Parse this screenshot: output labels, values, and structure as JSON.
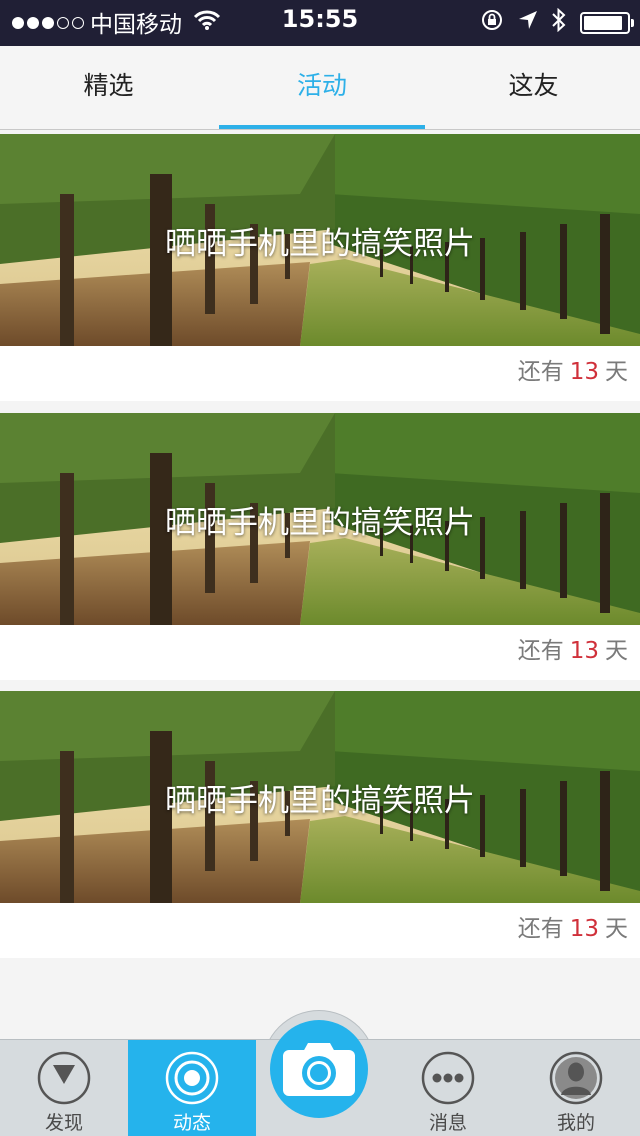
{
  "status_bar": {
    "carrier": "中国移动",
    "time": "15:55",
    "signal_bars_filled": 3,
    "signal_bars_total": 5,
    "battery_level": 0.9,
    "icons": [
      "wifi-icon",
      "orientation-lock-icon",
      "location-icon",
      "bluetooth-icon",
      "battery-icon"
    ]
  },
  "top_tabs": [
    {
      "label": "精选",
      "active": false
    },
    {
      "label": "活动",
      "active": true
    },
    {
      "label": "这友",
      "active": false
    }
  ],
  "activities": [
    {
      "title": "晒晒手机里的搞笑照片",
      "remaining_prefix": "还有",
      "remaining_days": "13",
      "remaining_suffix": "天"
    },
    {
      "title": "晒晒手机里的搞笑照片",
      "remaining_prefix": "还有",
      "remaining_days": "13",
      "remaining_suffix": "天"
    },
    {
      "title": "晒晒手机里的搞笑照片",
      "remaining_prefix": "还有",
      "remaining_days": "13",
      "remaining_suffix": "天"
    }
  ],
  "bottom_tabs": [
    {
      "label": "发现",
      "icon": "compass-icon",
      "active": false
    },
    {
      "label": "动态",
      "icon": "radar-icon",
      "active": true
    },
    {
      "label": "",
      "icon": "camera-icon",
      "active": false
    },
    {
      "label": "消息",
      "icon": "chat-bubble-icon",
      "active": false
    },
    {
      "label": "我的",
      "icon": "profile-avatar-icon",
      "active": false
    }
  ],
  "colors": {
    "accent": "#25b3ec",
    "status_bar_bg": "#201f35",
    "countdown_number": "#d0303a",
    "tab_bar_bg": "#d6dbde"
  }
}
